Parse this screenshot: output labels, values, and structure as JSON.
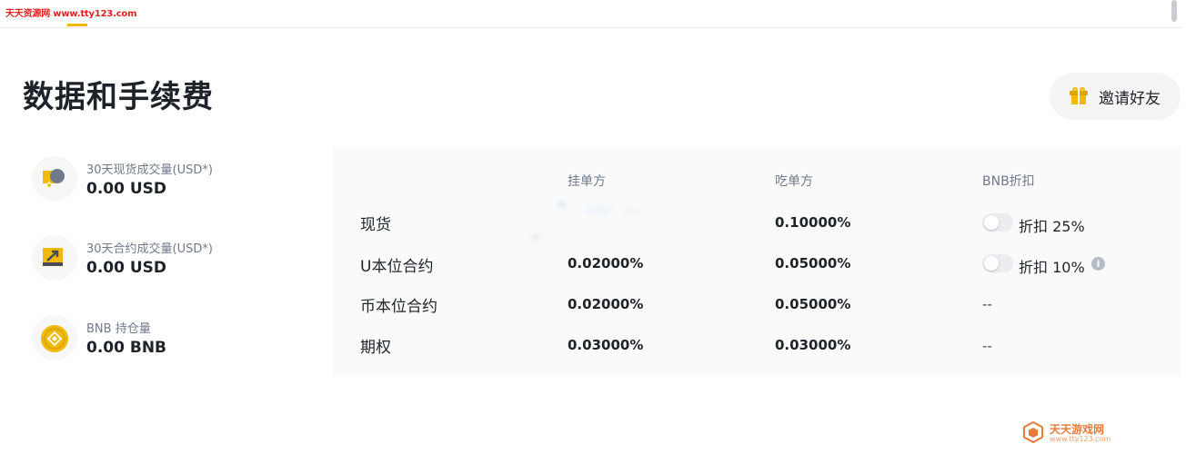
{
  "watermark": {
    "top": "天天资源网 www.tty123.com",
    "bottom_name": "天天游戏网",
    "bottom_url": "www.tty123.com"
  },
  "header": {
    "title": "数据和手续费",
    "invite_label": "邀请好友"
  },
  "stats": [
    {
      "label": "30天现货成交量(USD*)",
      "value": "0.00 USD",
      "icon": "spot-volume-icon"
    },
    {
      "label": "30天合约成交量(USD*)",
      "value": "0.00 USD",
      "icon": "futures-volume-icon"
    },
    {
      "label": "BNB 持仓量",
      "value": "0.00 BNB",
      "icon": "bnb-coin-icon"
    }
  ],
  "fees": {
    "columns": [
      "",
      "挂单方",
      "吃单方",
      "BNB折扣"
    ],
    "rows": [
      {
        "label": "现货",
        "maker": "",
        "taker": "0.10000%",
        "discount": "折扣 25%",
        "has_toggle": true
      },
      {
        "label": "U本位合约",
        "maker": "0.02000%",
        "taker": "0.05000%",
        "discount": "折扣 10%",
        "has_toggle": true
      },
      {
        "label": "币本位合约",
        "maker": "0.02000%",
        "taker": "0.05000%",
        "discount": "--",
        "has_toggle": false
      },
      {
        "label": "期权",
        "maker": "0.03000%",
        "taker": "0.03000%",
        "discount": "--",
        "has_toggle": false
      }
    ]
  },
  "colors": {
    "accent": "#F0B90B",
    "text_primary": "#1E2329",
    "text_secondary": "#707A8A",
    "panel_bg": "#FAFAFA"
  }
}
